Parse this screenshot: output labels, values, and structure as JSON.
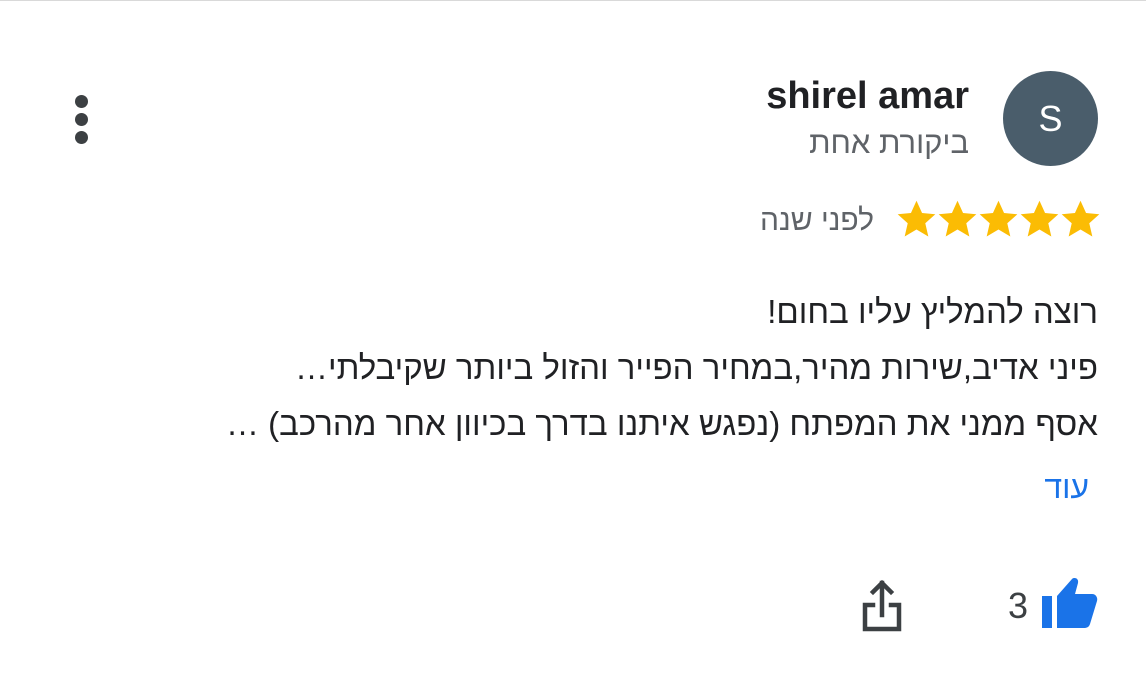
{
  "reviewer": {
    "name": "shirel amar",
    "initial": "S",
    "review_count_text": "ביקורת אחת",
    "avatar_color": "#4a5d6b"
  },
  "rating": {
    "stars": 5,
    "max_stars": 5,
    "star_color": "#fbbc04",
    "date_text": "לפני שנה"
  },
  "review": {
    "lines": [
      "רוצה להמליץ עליו בחום!",
      "פיני אדיב,שירות מהיר,במחיר הפייר והזול ביותר שקיבלתי…",
      "אסף ממני את המפתח (נפגש איתנו בדרך בכיוון אחר מהרכב) …"
    ],
    "more_label": "עוד"
  },
  "actions": {
    "like_count": "3",
    "like_icon": "thumbs-up-icon",
    "share_icon": "share-icon",
    "menu_icon": "more-vert-icon",
    "accent_color": "#1a73e8"
  }
}
